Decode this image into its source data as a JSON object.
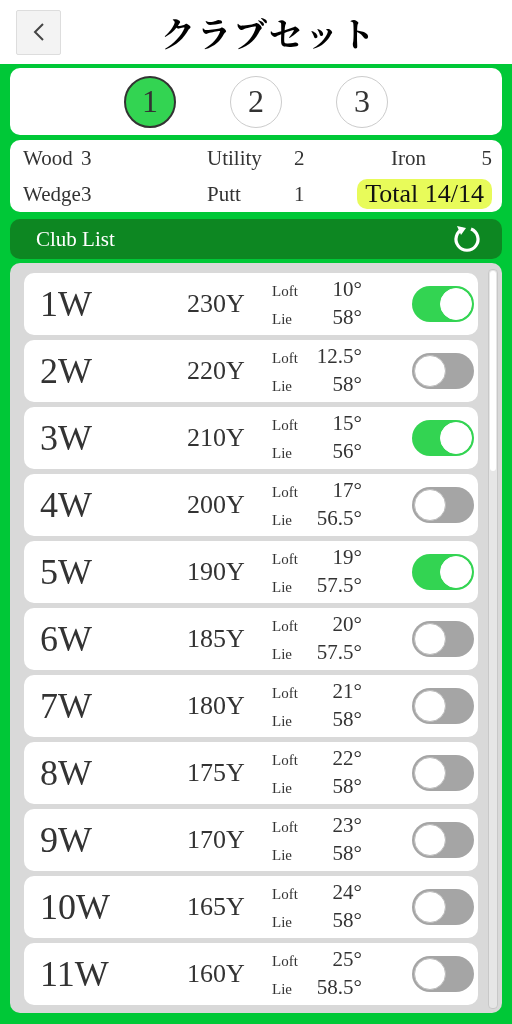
{
  "header": {
    "title": "クラブセット"
  },
  "sets": [
    {
      "label": "1",
      "selected": true
    },
    {
      "label": "2",
      "selected": false
    },
    {
      "label": "3",
      "selected": false
    }
  ],
  "stats": [
    {
      "label": "Wood",
      "count": "3"
    },
    {
      "label": "Utility",
      "count": "2"
    },
    {
      "label": "Iron",
      "count": "5"
    },
    {
      "label": "Wedge",
      "count": "3"
    },
    {
      "label": "Putt",
      "count": "1"
    }
  ],
  "total": "Total 14/14",
  "list_title": "Club List",
  "clubs": [
    {
      "name": "1W",
      "distance": "230Y",
      "loft_label": "Loft",
      "loft": "10°",
      "lie_label": "Lie",
      "lie": "58°",
      "on": true
    },
    {
      "name": "2W",
      "distance": "220Y",
      "loft_label": "Loft",
      "loft": "12.5°",
      "lie_label": "Lie",
      "lie": "58°",
      "on": false
    },
    {
      "name": "3W",
      "distance": "210Y",
      "loft_label": "Loft",
      "loft": "15°",
      "lie_label": "Lie",
      "lie": "56°",
      "on": true
    },
    {
      "name": "4W",
      "distance": "200Y",
      "loft_label": "Loft",
      "loft": "17°",
      "lie_label": "Lie",
      "lie": "56.5°",
      "on": false
    },
    {
      "name": "5W",
      "distance": "190Y",
      "loft_label": "Loft",
      "loft": "19°",
      "lie_label": "Lie",
      "lie": "57.5°",
      "on": true
    },
    {
      "name": "6W",
      "distance": "185Y",
      "loft_label": "Loft",
      "loft": "20°",
      "lie_label": "Lie",
      "lie": "57.5°",
      "on": false
    },
    {
      "name": "7W",
      "distance": "180Y",
      "loft_label": "Loft",
      "loft": "21°",
      "lie_label": "Lie",
      "lie": "58°",
      "on": false
    },
    {
      "name": "8W",
      "distance": "175Y",
      "loft_label": "Loft",
      "loft": "22°",
      "lie_label": "Lie",
      "lie": "58°",
      "on": false
    },
    {
      "name": "9W",
      "distance": "170Y",
      "loft_label": "Loft",
      "loft": "23°",
      "lie_label": "Lie",
      "lie": "58°",
      "on": false
    },
    {
      "name": "10W",
      "distance": "165Y",
      "loft_label": "Loft",
      "loft": "24°",
      "lie_label": "Lie",
      "lie": "58°",
      "on": false
    },
    {
      "name": "11W",
      "distance": "160Y",
      "loft_label": "Loft",
      "loft": "25°",
      "lie_label": "Lie",
      "lie": "58.5°",
      "on": false
    }
  ]
}
